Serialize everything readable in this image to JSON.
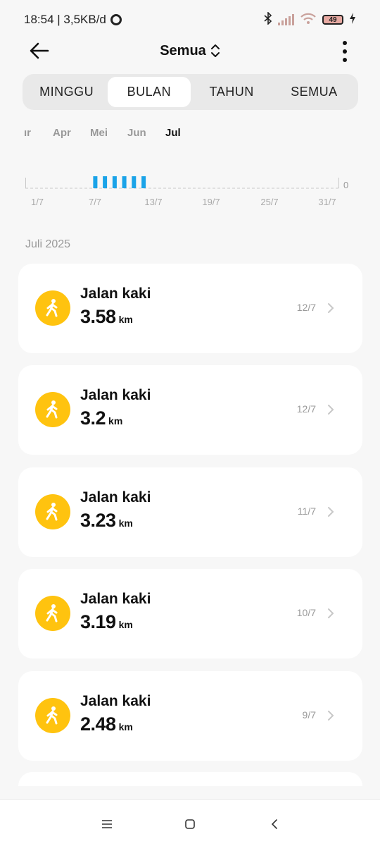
{
  "status_bar": {
    "time_speed": "18:54 | 3,5KB/d",
    "battery": "49"
  },
  "header": {
    "title": "Semua",
    "back_icon": "arrow-left-icon",
    "more_icon": "more-vertical-icon"
  },
  "tabs": [
    {
      "label": "MINGGU",
      "active": false
    },
    {
      "label": "BULAN",
      "active": true
    },
    {
      "label": "TAHUN",
      "active": false
    },
    {
      "label": "SEMUA",
      "active": false
    }
  ],
  "months": [
    "ır",
    "Apr",
    "Mei",
    "Jun",
    "Jul"
  ],
  "active_month": "Jul",
  "chart_data": {
    "type": "bar",
    "x": [
      "7/7",
      "8/7",
      "9/7",
      "10/7",
      "11/7",
      "12/7"
    ],
    "values": [
      1,
      1,
      1,
      1,
      1,
      1
    ],
    "x_tick_labels": [
      "1/7",
      "7/7",
      "13/7",
      "19/7",
      "25/7",
      "31/7"
    ],
    "y_label_right": "0",
    "color": "#1aa3e8"
  },
  "section_label": "Juli 2025",
  "activities": [
    {
      "type": "Jalan kaki",
      "distance": "3.58",
      "unit": "km",
      "date": "12/7"
    },
    {
      "type": "Jalan kaki",
      "distance": "3.2",
      "unit": "km",
      "date": "12/7"
    },
    {
      "type": "Jalan kaki",
      "distance": "3.23",
      "unit": "km",
      "date": "11/7"
    },
    {
      "type": "Jalan kaki",
      "distance": "3.19",
      "unit": "km",
      "date": "10/7"
    },
    {
      "type": "Jalan kaki",
      "distance": "2.48",
      "unit": "km",
      "date": "9/7"
    }
  ],
  "colors": {
    "accent": "#ffc30f",
    "bar": "#1aa3e8",
    "background": "#f7f7f7"
  },
  "nav": {
    "menu_icon": "menu-icon",
    "home_icon": "home-square-icon",
    "back_icon": "back-chevron-icon"
  }
}
